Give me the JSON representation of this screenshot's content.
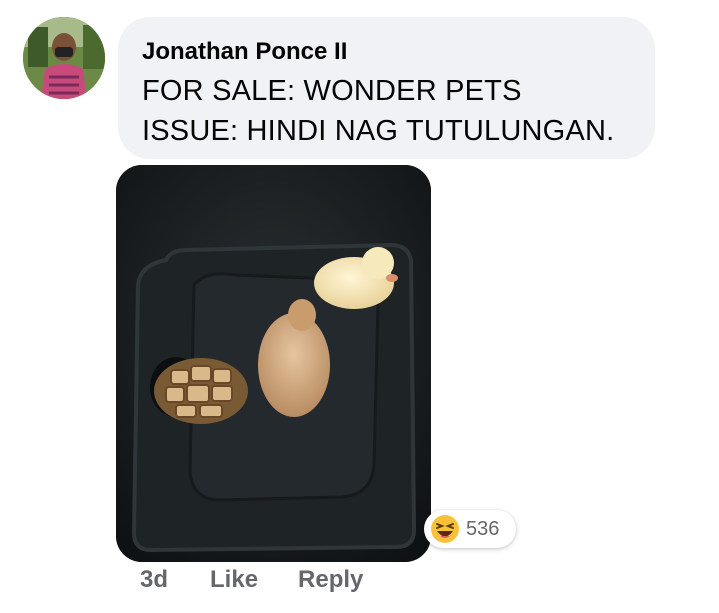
{
  "comment": {
    "author": "Jonathan Ponce II",
    "lines": [
      "FOR SALE: WONDER PETS",
      "ISSUE: HINDI NAG TUTULUNGAN."
    ]
  },
  "reactions": {
    "icon": "laughing-emoji-icon",
    "count": "536"
  },
  "actions": {
    "time": "3d",
    "like": "Like",
    "reply": "Reply"
  },
  "colors": {
    "bubble": "#f0f2f5",
    "text": "#050505",
    "muted": "#65676b"
  }
}
